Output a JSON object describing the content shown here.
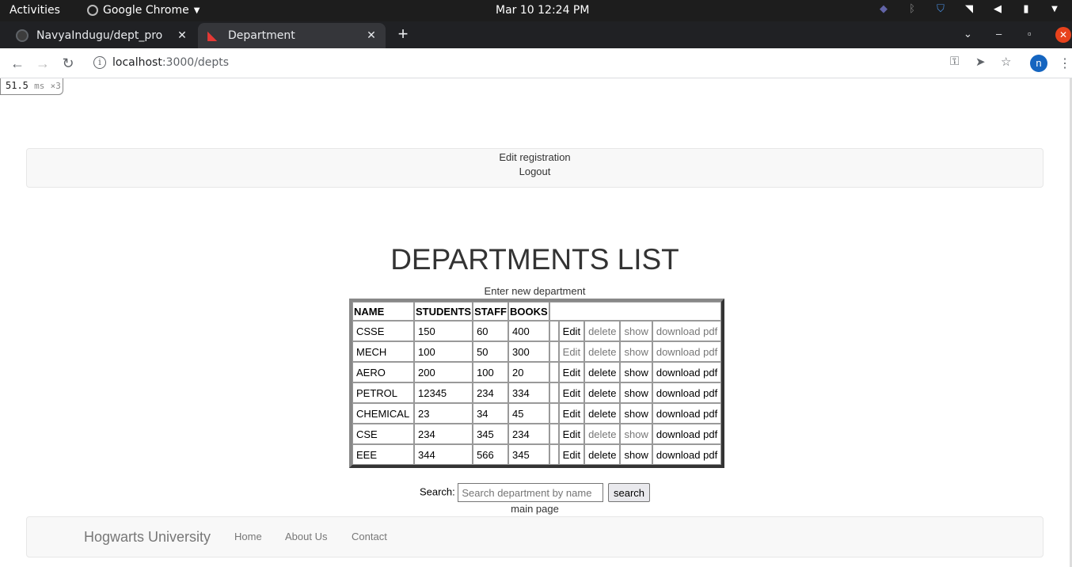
{
  "os": {
    "activities": "Activities",
    "app_name": "Google Chrome",
    "clock": "Mar 10  12:24 PM"
  },
  "browser": {
    "tabs": [
      {
        "title": "NavyaIndugu/dept_pro",
        "active": false
      },
      {
        "title": "Department",
        "active": true
      }
    ],
    "url_host": "localhost",
    "url_path": ":3000/depts",
    "profile_initial": "n"
  },
  "perf_badge": {
    "value": "51.5",
    "unit": "ms",
    "count": "×3"
  },
  "topnav": {
    "edit_registration": "Edit registration",
    "logout": "Logout"
  },
  "page": {
    "title": "DEPARTMENTS LIST",
    "new_department_link": "Enter new department",
    "search_label": "Search:",
    "search_placeholder": "Search department by name",
    "search_button": "search",
    "main_page_link": "main page"
  },
  "table": {
    "headers": [
      "NAME",
      "STUDENTS",
      "STAFF",
      "BOOKS"
    ],
    "rows": [
      {
        "name": "CSSE",
        "students": "150",
        "staff": "60",
        "books": "400",
        "edit": "Edit",
        "delete": "delete",
        "show": "show",
        "pdf": "download pdf"
      },
      {
        "name": "MECH",
        "students": "100",
        "staff": "50",
        "books": "300",
        "edit": "Edit",
        "delete": "delete",
        "show": "show",
        "pdf": "download pdf"
      },
      {
        "name": "AERO",
        "students": "200",
        "staff": "100",
        "books": "20",
        "edit": "Edit",
        "delete": "delete",
        "show": "show",
        "pdf": "download pdf"
      },
      {
        "name": "PETROL",
        "students": "12345",
        "staff": "234",
        "books": "334",
        "edit": "Edit",
        "delete": "delete",
        "show": "show",
        "pdf": "download pdf"
      },
      {
        "name": "CHEMICAL",
        "students": "23",
        "staff": "34",
        "books": "45",
        "edit": "Edit",
        "delete": "delete",
        "show": "show",
        "pdf": "download pdf"
      },
      {
        "name": "CSE",
        "students": "234",
        "staff": "345",
        "books": "234",
        "edit": "Edit",
        "delete": "delete",
        "show": "show",
        "pdf": "download pdf"
      },
      {
        "name": "EEE",
        "students": "344",
        "staff": "566",
        "books": "345",
        "edit": "Edit",
        "delete": "delete",
        "show": "show",
        "pdf": "download pdf"
      }
    ]
  },
  "footer": {
    "brand": "Hogwarts University",
    "links": [
      "Home",
      "About Us",
      "Contact"
    ]
  },
  "icons": {
    "favicon_inactive": "github-icon",
    "favicon_active": "rails-icon",
    "colors": {
      "muted_link": "#777777",
      "accent_close": "#e8421c"
    }
  }
}
